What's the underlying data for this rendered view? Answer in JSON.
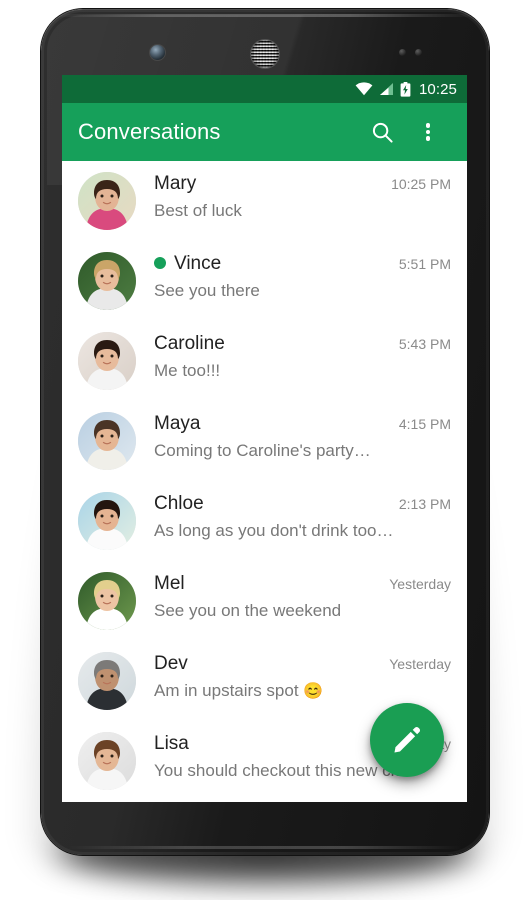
{
  "device": {
    "name": "android-phone-mockup"
  },
  "status_bar": {
    "clock": "10:25",
    "icons": [
      "wifi-icon",
      "cell-signal-icon",
      "battery-charging-icon"
    ]
  },
  "app_bar": {
    "title": "Conversations",
    "search_icon": "search-icon",
    "overflow_icon": "overflow-menu-icon"
  },
  "fab": {
    "icon": "pencil-compose-icon",
    "color": "#1a9e53"
  },
  "colors": {
    "status_bar": "#0e6b38",
    "app_bar": "#16a05a",
    "accent": "#16a05a",
    "name_text": "#222222",
    "preview_text": "#787878",
    "time_text": "#8a8a8a"
  },
  "conversations": [
    {
      "name": "Mary",
      "preview": "Best of luck",
      "time": "10:25 PM",
      "online": false,
      "emoji": ""
    },
    {
      "name": "Vince",
      "preview": "See you there",
      "time": "5:51 PM",
      "online": true,
      "emoji": ""
    },
    {
      "name": "Caroline",
      "preview": "Me too!!!",
      "time": "5:43 PM",
      "online": false,
      "emoji": ""
    },
    {
      "name": "Maya",
      "preview": "Coming to Caroline's party…",
      "time": "4:15 PM",
      "online": false,
      "emoji": ""
    },
    {
      "name": "Chloe",
      "preview": "As long as you don't drink too…",
      "time": "2:13 PM",
      "online": false,
      "emoji": ""
    },
    {
      "name": "Mel",
      "preview": "See you on the weekend",
      "time": "Yesterday",
      "online": false,
      "emoji": ""
    },
    {
      "name": "Dev",
      "preview": "Am in upstairs spot ",
      "time": "Yesterday",
      "online": false,
      "emoji": "😊"
    },
    {
      "name": "Lisa",
      "preview": "You should checkout this new club",
      "time": "Yesterday",
      "online": false,
      "emoji": ""
    }
  ]
}
